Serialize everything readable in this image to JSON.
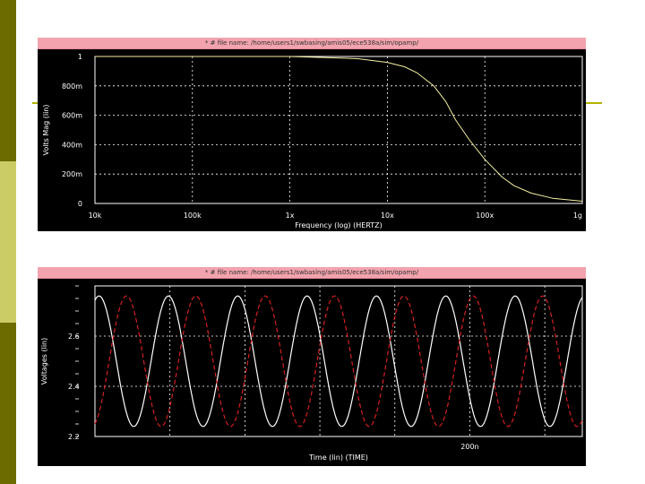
{
  "slide": {
    "colors": {
      "sidebar_dark": "#6b6b00",
      "sidebar_light": "#cccc66",
      "accent_line": "#b3b300"
    }
  },
  "chart_data": [
    {
      "type": "line",
      "window_title": "* # file name: /home/users1/swbasing/amis05/ece538a/sim/opamp/",
      "xlabel": "Frequency (log) (HERTZ)",
      "ylabel": "Volts Mag (lin)",
      "x_scale": "log",
      "xlim": [
        10000,
        1000000000
      ],
      "ylim": [
        0,
        1
      ],
      "x_ticks": [
        {
          "value": 10000,
          "label": "10k"
        },
        {
          "value": 100000,
          "label": "100k"
        },
        {
          "value": 1000000,
          "label": "1x"
        },
        {
          "value": 10000000,
          "label": "10x"
        },
        {
          "value": 100000000,
          "label": "100x"
        },
        {
          "value": 1000000000,
          "label": "1g"
        }
      ],
      "y_ticks": [
        {
          "value": 0,
          "label": "0"
        },
        {
          "value": 0.2,
          "label": "200m"
        },
        {
          "value": 0.4,
          "label": "400m"
        },
        {
          "value": 0.6,
          "label": "600m"
        },
        {
          "value": 0.8,
          "label": "800m"
        },
        {
          "value": 1,
          "label": "1"
        }
      ],
      "grid": true,
      "colors": {
        "background": "#000000",
        "grid": "#ffffff",
        "axis_text": "#ffffff"
      },
      "series": [
        {
          "color": "#f5f0a0",
          "dash": false,
          "points": [
            [
              10000,
              1.0
            ],
            [
              1000000,
              1.0
            ],
            [
              3000000,
              0.99
            ],
            [
              5000000,
              0.985
            ],
            [
              10000000,
              0.96
            ],
            [
              15000000,
              0.93
            ],
            [
              20000000,
              0.89
            ],
            [
              30000000,
              0.8
            ],
            [
              40000000,
              0.69
            ],
            [
              50000000,
              0.57
            ],
            [
              70000000,
              0.43
            ],
            [
              100000000,
              0.3
            ],
            [
              150000000,
              0.18
            ],
            [
              200000000,
              0.12
            ],
            [
              300000000,
              0.07
            ],
            [
              500000000,
              0.035
            ],
            [
              1000000000,
              0.015
            ]
          ]
        }
      ]
    },
    {
      "type": "line",
      "window_title": "* # file name: /home/users1/swbasing/amis05/ece538a/sim/opamp/",
      "xlabel": "Time (lin) (TIME)",
      "ylabel": "Voltages (lin)",
      "x_scale": "linear",
      "xlim": [
        0,
        260
      ],
      "ylim": [
        2.2,
        2.8
      ],
      "x_ticks": [
        {
          "value": 200,
          "label": "200n"
        }
      ],
      "y_ticks": [
        {
          "value": 2.2,
          "label": "2.2"
        },
        {
          "value": 2.4,
          "label": "2.4"
        },
        {
          "value": 2.6,
          "label": "2.6"
        }
      ],
      "grid": true,
      "colors": {
        "background": "#000000",
        "grid": "#ffffff",
        "axis_text": "#ffffff"
      },
      "series": [
        {
          "color": "#ffffff",
          "dash": false,
          "offset": 2.5,
          "amplitude": 0.26,
          "period": 37,
          "phase": 1.2
        },
        {
          "color": "#d42020",
          "dash": true,
          "offset": 2.5,
          "amplitude": 0.26,
          "period": 37,
          "phase": 5.0
        }
      ]
    }
  ]
}
